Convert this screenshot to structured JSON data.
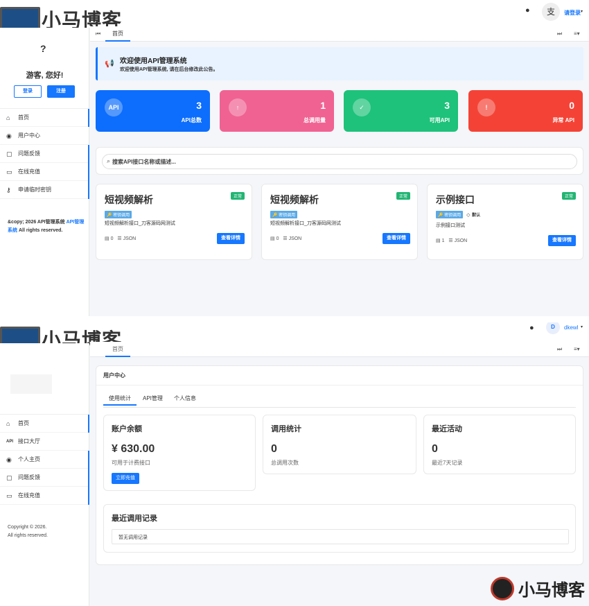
{
  "brand": "小马博客",
  "s1": {
    "top_user": "请登录",
    "sidebar": {
      "guest_icon": "?",
      "greeting": "游客, 您好!",
      "login": "登录",
      "register": "注册",
      "items": [
        {
          "label": "首页",
          "icon": "home-icon"
        },
        {
          "label": "用户中心",
          "icon": "user-icon"
        },
        {
          "label": "问题反馈",
          "icon": "feedback-icon"
        },
        {
          "label": "在线充值",
          "icon": "card-icon"
        },
        {
          "label": "申请临时密钥",
          "icon": "key-icon"
        }
      ],
      "footer_prefix": "&copy; 2026 API管理系统",
      "footer_link": "API管理系统",
      "footer_suffix": "All rights reserved."
    },
    "tab": "首页",
    "notice": {
      "title": "欢迎使用API管理系统",
      "text": "欢迎使用API管理系统, 请在后台修改此公告。"
    },
    "stats": [
      {
        "icon": "API",
        "value": "3",
        "label": "API总数",
        "color": "#0d6efd"
      },
      {
        "icon": "↑",
        "value": "1",
        "label": "总调用量",
        "color": "#f06292"
      },
      {
        "icon": "✓",
        "value": "3",
        "label": "可用API",
        "color": "#1ec27a"
      },
      {
        "icon": "!",
        "value": "0",
        "label": "异常 API",
        "color": "#f44336"
      }
    ],
    "search_placeholder": "搜索API接口名称或描述...",
    "apis": [
      {
        "title": "短视频解析",
        "status": "正常",
        "tag": "密钥调用",
        "extra_tag": "",
        "desc": "短视频解析接口_刀客源码网测试",
        "count": "0",
        "format": "JSON",
        "button": "查看详情"
      },
      {
        "title": "短视频解析",
        "status": "正常",
        "tag": "密钥调用",
        "extra_tag": "",
        "desc": "短视频解析接口_刀客源码网测试",
        "count": "0",
        "format": "JSON",
        "button": "查看详情"
      },
      {
        "title": "示例接口",
        "status": "正常",
        "tag": "密钥调用",
        "extra_tag": "默认",
        "desc": "示例接口测试",
        "count": "1",
        "format": "JSON",
        "button": "查看详情"
      }
    ]
  },
  "s2": {
    "user": "dkewl",
    "avatar_letter": "D",
    "tab": "首页",
    "sidebar": {
      "items": [
        {
          "label": "首页",
          "icon": "home-icon"
        },
        {
          "label": "接口大厅",
          "icon": "api-icon"
        },
        {
          "label": "个人主页",
          "icon": "user-icon"
        },
        {
          "label": "问题反馈",
          "icon": "feedback-icon"
        },
        {
          "label": "在线充值",
          "icon": "card-icon"
        }
      ],
      "footer_line1": "Copyright © 2026.",
      "footer_line2": "All rights reserved."
    },
    "panel_title": "用户中心",
    "tabs": [
      "使用统计",
      "API管理",
      "个人信息"
    ],
    "balance": {
      "title": "账户余额",
      "value": "¥ 630.00",
      "sub": "可用于计费接口",
      "button": "立即充值"
    },
    "calls": {
      "title": "调用统计",
      "value": "0",
      "sub": "总调用次数"
    },
    "activity": {
      "title": "最近活动",
      "value": "0",
      "sub": "最近7天记录"
    },
    "recent": {
      "title": "最近调用记录",
      "empty": "暂无调用记录"
    }
  },
  "watermark": "小马博客"
}
